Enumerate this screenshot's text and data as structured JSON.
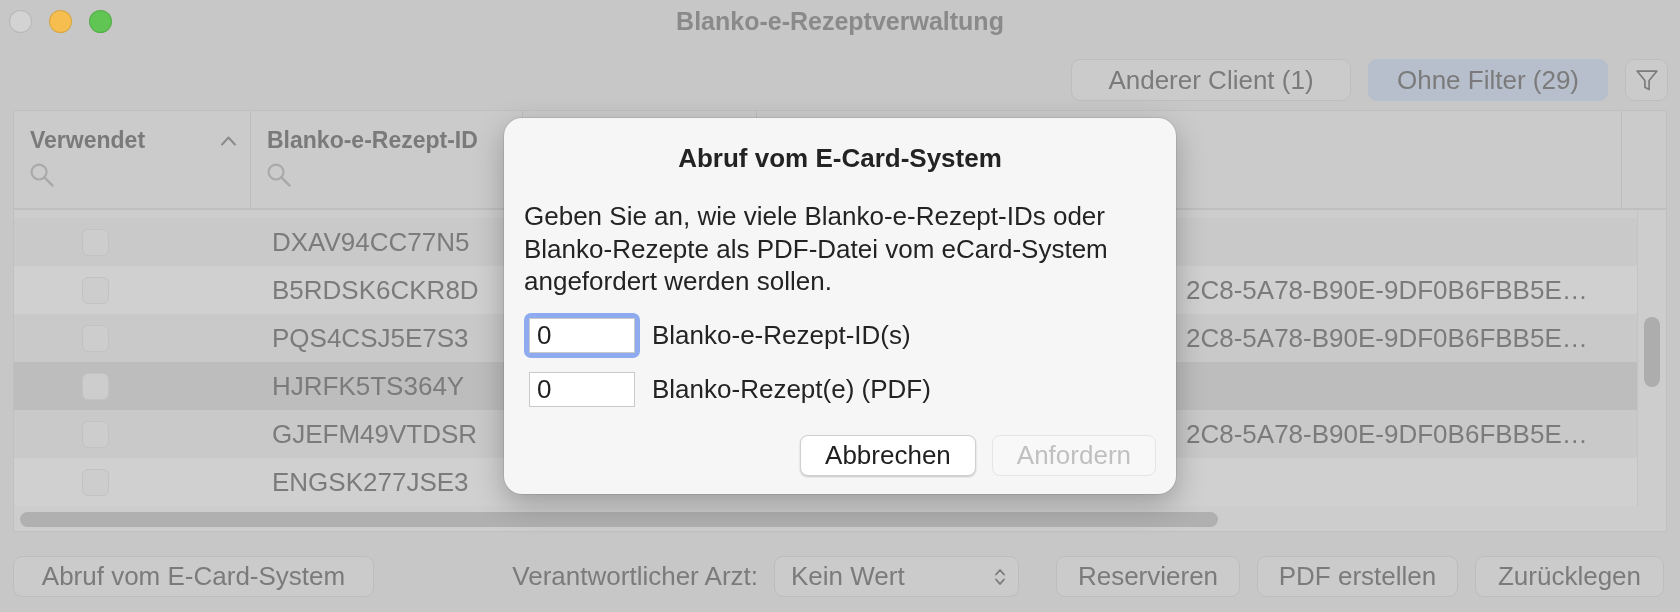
{
  "window": {
    "title": "Blanko-e-Rezeptverwaltung",
    "controls": [
      {
        "kind": "close",
        "disabled": true
      },
      {
        "kind": "minimize",
        "disabled": false
      },
      {
        "kind": "zoom",
        "disabled": false
      }
    ]
  },
  "toolbar": {
    "filters": [
      {
        "label": "Anderer Client (1)",
        "selected": false
      },
      {
        "label": "Ohne Filter (29)",
        "selected": true
      }
    ]
  },
  "table": {
    "columns": [
      {
        "label": "Verwendet",
        "sorted": true
      },
      {
        "label": "Blanko-e-Rezept-ID",
        "sorted": false
      }
    ],
    "rows": [
      {
        "used": false,
        "id": "DXAV94CC77N5",
        "selected": false
      },
      {
        "used": false,
        "id": "B5RDSK6CKR8D",
        "column_4": "2C8-5A78-B90E-9DF0B6FBB5E…",
        "selected": false
      },
      {
        "used": false,
        "id": "PQS4CSJ5E7S3",
        "column_4": "2C8-5A78-B90E-9DF0B6FBB5E…",
        "selected": false
      },
      {
        "used": false,
        "id": "HJRFK5TS364Y",
        "selected": true
      },
      {
        "used": false,
        "id": "GJEFM49VTDSR",
        "column_4": "2C8-5A78-B90E-9DF0B6FBB5E…",
        "selected": false
      },
      {
        "used": false,
        "id": "ENGSK277JSE3",
        "selected": false
      }
    ]
  },
  "dialog": {
    "title": "Abruf vom E-Card-System",
    "message": "Geben Sie an, wie viele Blanko-e-Rezept-IDs oder Blanko-Rezepte als PDF-Datei vom eCard-System angefordert werden sollen.",
    "fields": [
      {
        "value": "0",
        "label": "Blanko-e-Rezept-ID(s)",
        "focused": true
      },
      {
        "value": "0",
        "label": "Blanko-Rezept(e) (PDF)",
        "focused": false
      }
    ],
    "buttons": [
      {
        "label": "Abbrechen",
        "disabled": false
      },
      {
        "label": "Anfordern",
        "disabled": true
      }
    ]
  },
  "bottom_bar": {
    "fetch_button": "Abruf vom E-Card-System",
    "doctor": {
      "label": "Verantwortlicher Arzt:",
      "value": "Kein Wert"
    },
    "actions": [
      "Reservieren",
      "PDF erstellen",
      "Zurücklegen"
    ]
  }
}
